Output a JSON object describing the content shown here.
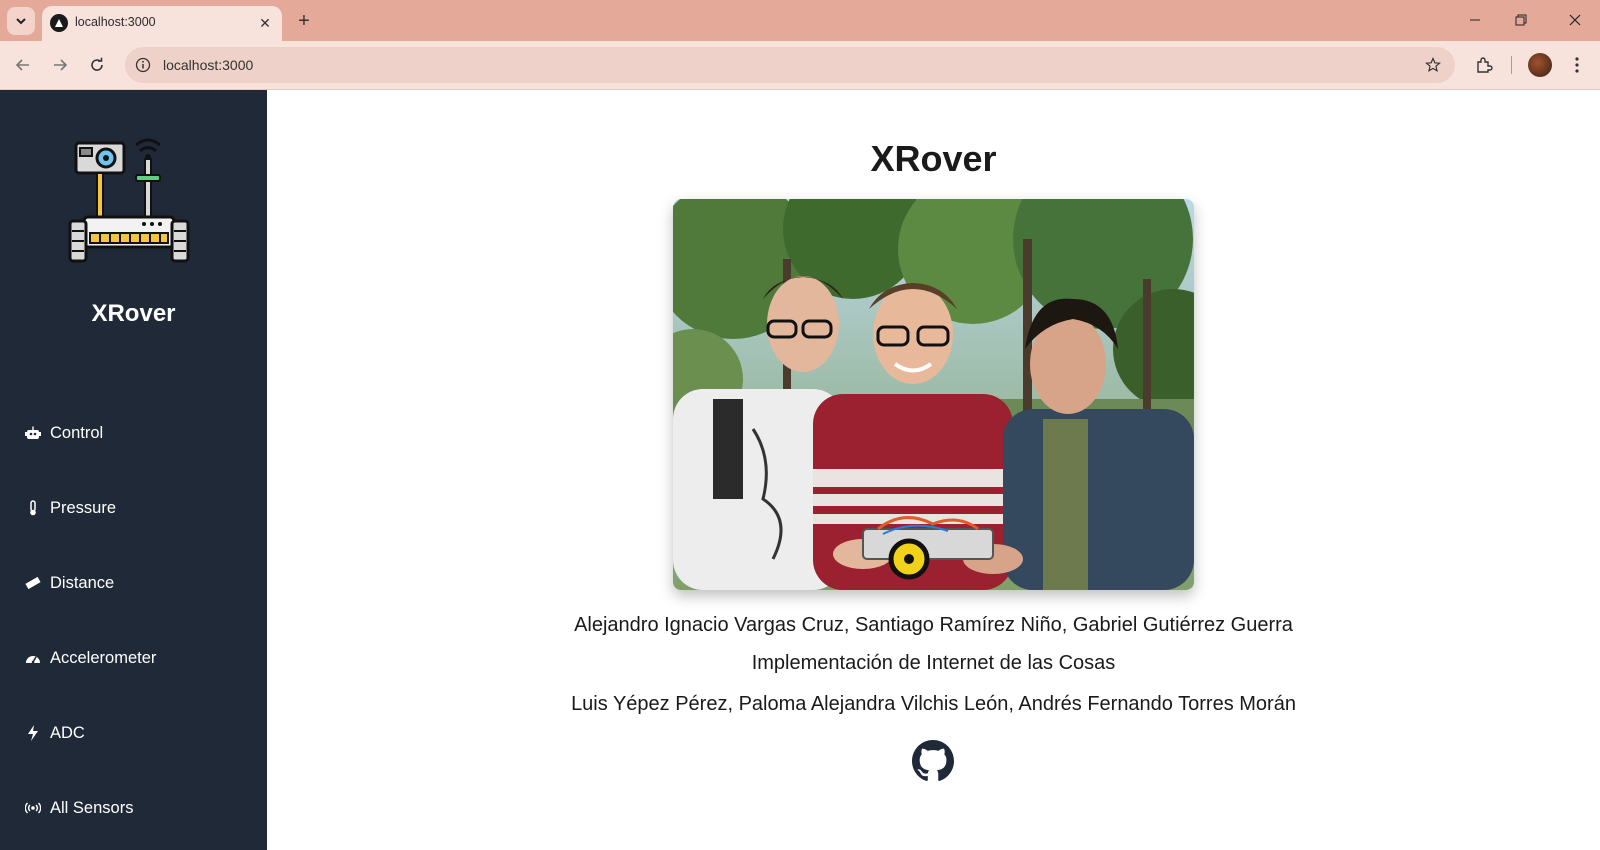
{
  "browser": {
    "tab_title": "localhost:3000",
    "url": "localhost:3000"
  },
  "sidebar": {
    "title": "XRover",
    "items": [
      {
        "label": "Control",
        "icon": "robot-icon"
      },
      {
        "label": "Pressure",
        "icon": "thermometer-icon"
      },
      {
        "label": "Distance",
        "icon": "ruler-icon"
      },
      {
        "label": "Accelerometer",
        "icon": "gauge-icon"
      },
      {
        "label": "ADC",
        "icon": "bolt-icon"
      },
      {
        "label": "All Sensors",
        "icon": "broadcast-icon"
      }
    ]
  },
  "main": {
    "title": "XRover",
    "authors": "Alejandro Ignacio Vargas Cruz, Santiago Ramírez Niño, Gabriel Gutiérrez Guerra",
    "course": "Implementación de Internet de las Cosas",
    "professors": "Luis Yépez Pérez, Paloma Alejandra Vilchis León, Andrés Fernando Torres Morán"
  },
  "colors": {
    "sidebar_bg": "#1f2937",
    "tabstrip_bg": "#e4a999",
    "toolbar_bg": "#f7e3dc"
  }
}
